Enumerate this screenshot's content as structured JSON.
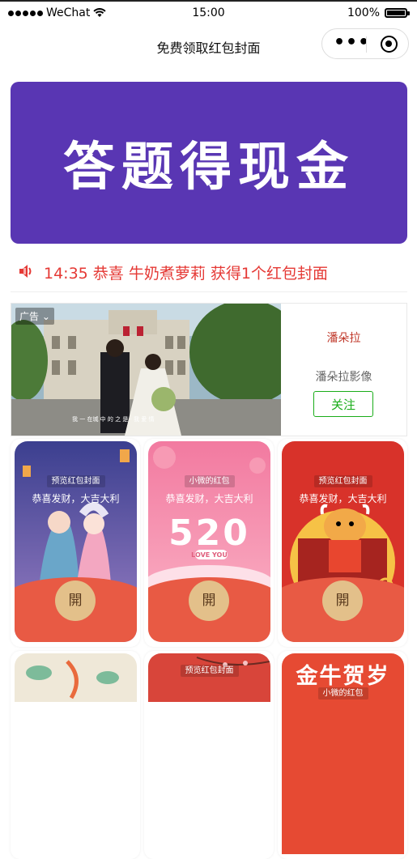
{
  "status_bar": {
    "carrier": "WeChat",
    "time": "15:00",
    "battery": "100%",
    "battery_level": 1.0
  },
  "nav": {
    "title": "免费领取红包封面"
  },
  "banner": {
    "text": "答题得现金",
    "background": "#5936b3"
  },
  "notice": {
    "text": "14:35 恭喜 牛奶煮萝莉 获得1个红包封面",
    "color": "#e53935"
  },
  "ad": {
    "tag": "广告",
    "brand_logo": "潘朵拉",
    "brand_name": "潘朵拉影像",
    "follow_label": "关注",
    "photo_caption": "我 一 在城 中 的 之 是 · 我 爱 情"
  },
  "cards": [
    {
      "source": "预览红包封面",
      "blessing": "恭喜发财，大吉大利",
      "open": "開"
    },
    {
      "source": "小微的红包",
      "blessing": "恭喜发财，大吉大利",
      "open": "開",
      "art_text": "520",
      "art_sub": "LOVE YOU"
    },
    {
      "source": "预览红包封面",
      "blessing": "恭喜发财，大吉大利",
      "open": "開"
    },
    {
      "source": ""
    },
    {
      "source": "预览红包封面"
    },
    {
      "source": "小微的红包",
      "title": "金牛贺岁"
    }
  ]
}
